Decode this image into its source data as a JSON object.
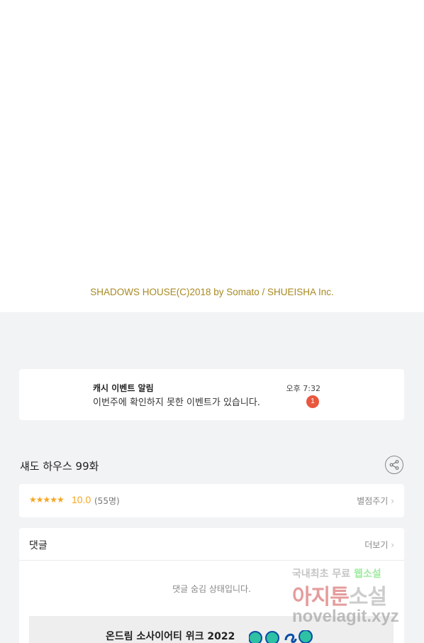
{
  "copyright": "SHADOWS HOUSE(C)2018 by Somato / SHUEISHA Inc.",
  "notice": {
    "title": "캐시 이벤트 알림",
    "body": "이번주에 확인하지 못한 이벤트가 있습니다.",
    "time": "오후 7:32",
    "badge": "1"
  },
  "episode": {
    "title": "섀도 하우스 99화",
    "share_icon": "share-icon"
  },
  "rating": {
    "stars": "★★★★★",
    "score": "10.0",
    "count": "(55명)",
    "rate_label": "별점주기",
    "accent": "#f5a623"
  },
  "comments": {
    "label": "댓글",
    "more_label": "더보기",
    "hidden_message": "댓글 숨김 상태입니다."
  },
  "banner": {
    "text": "온드림 소사이어티 위크 2022"
  },
  "watermark": {
    "line1_a": "국내최초 무료",
    "line1_b": "웹소설",
    "line2_a": "아지툰",
    "line2_b": "소설",
    "line3": "novelagit.xyz"
  }
}
